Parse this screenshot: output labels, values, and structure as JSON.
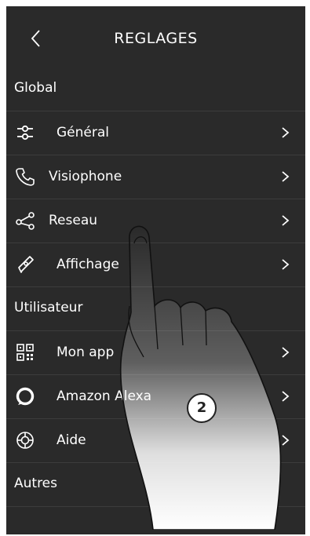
{
  "header": {
    "title": "REGLAGES",
    "back_icon": "chevron-left-icon"
  },
  "sections": {
    "global": "Global",
    "user": "Utilisateur",
    "others": "Autres"
  },
  "items": [
    {
      "label": "Général",
      "icon": "sliders-icon"
    },
    {
      "label": "Visiophone",
      "icon": "phone-icon"
    },
    {
      "label": "Reseau",
      "icon": "network-share-icon"
    },
    {
      "label": "Affichage",
      "icon": "display-pen-icon"
    },
    {
      "label": "Mon app",
      "icon": "qr-code-icon"
    },
    {
      "label": "Amazon Alexa",
      "icon": "alexa-ring-icon"
    },
    {
      "label": "Aide",
      "icon": "lifebuoy-icon"
    }
  ],
  "overlay": {
    "step_number": "2"
  },
  "colors": {
    "background": "#2a2a2a",
    "text": "#ffffff",
    "divider": "#3c3c3c"
  }
}
